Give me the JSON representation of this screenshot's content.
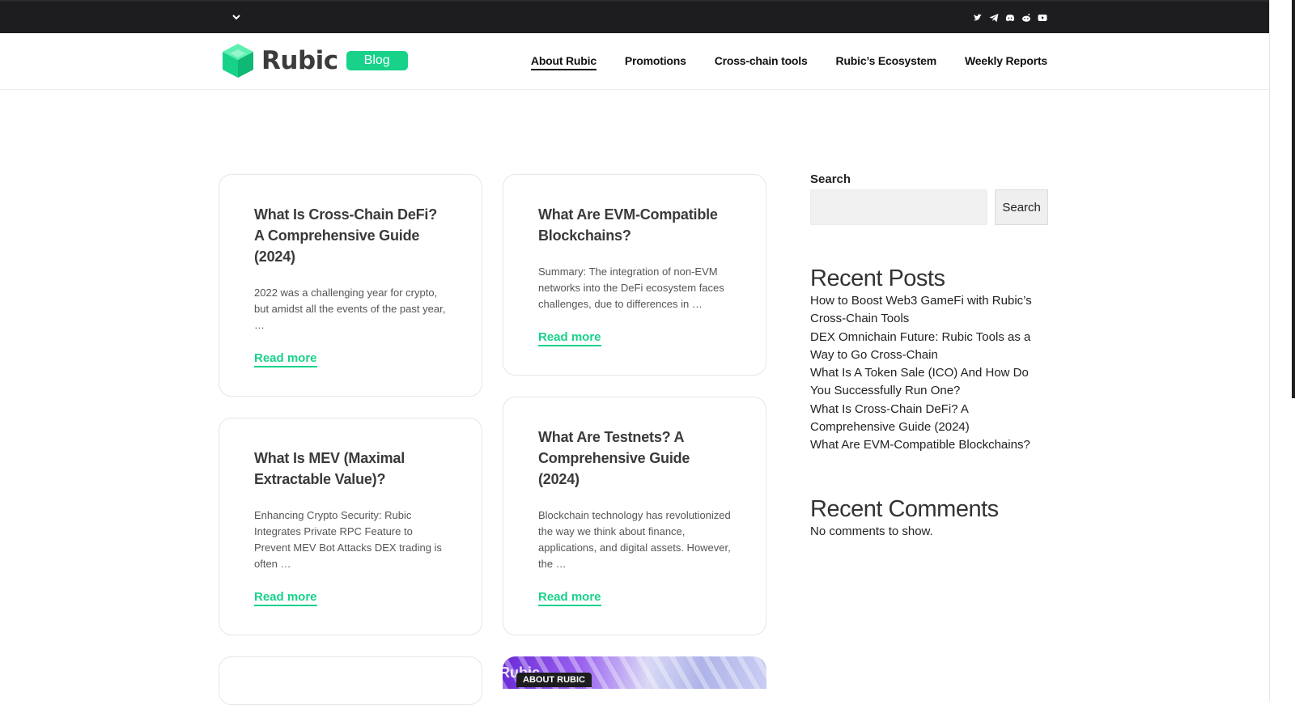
{
  "topbar": {
    "dropdown_icon": "chevron-down-icon",
    "social_icons": [
      "twitter-icon",
      "telegram-icon",
      "discord-icon",
      "reddit-icon",
      "youtube-icon"
    ]
  },
  "header": {
    "logo_text": "Rubic",
    "logo_badge": "Blog",
    "nav": [
      {
        "label": "About Rubic"
      },
      {
        "label": "Promotions"
      },
      {
        "label": "Cross-chain tools"
      },
      {
        "label": "Rubic’s Ecosystem"
      },
      {
        "label": "Weekly Reports"
      }
    ]
  },
  "posts": [
    {
      "title": "What Is Cross-Chain DeFi? A Comprehensive Guide (2024)",
      "excerpt": "2022 was a challenging year for crypto, but amidst all the events of the past year, …",
      "read_more": "Read more"
    },
    {
      "title": "What Are EVM-Compatible Blockchains?",
      "excerpt": "Summary: The integration of non-EVM networks into the DeFi ecosystem faces challenges, due to differences in …",
      "read_more": "Read more"
    },
    {
      "title": "What Is MEV (Maximal Extractable Value)?",
      "excerpt": "Enhancing Crypto Security: Rubic Integrates Private RPC Feature to Prevent MEV Bot Attacks DEX trading is often …",
      "read_more": "Read more"
    },
    {
      "title": "What Are Testnets? A Comprehensive Guide (2024)",
      "excerpt": "Blockchain technology has revolutionized the way we think about finance, applications, and digital assets. However, the …",
      "read_more": "Read more"
    }
  ],
  "image_card": {
    "category": "ABOUT RUBIC",
    "image_text": "Rubic"
  },
  "sidebar": {
    "search_label": "Search",
    "search_button": "Search",
    "search_value": "",
    "recent_posts_title": "Recent Posts",
    "recent_posts": [
      "How to Boost Web3 GameFi with Rubic’s Cross-Chain Tools",
      "DEX Omnichain Future: Rubic Tools as a Way to Go Cross-Chain",
      "What Is A Token Sale (ICO) And How Do You Successfully Run One?",
      "What Is Cross-Chain DeFi? A Comprehensive Guide (2024)",
      "What Are EVM-Compatible Blockchains?"
    ],
    "recent_comments_title": "Recent Comments",
    "no_comments": "No comments to show."
  },
  "colors": {
    "accent": "#18d28a",
    "topbar": "#1d1d1f"
  }
}
